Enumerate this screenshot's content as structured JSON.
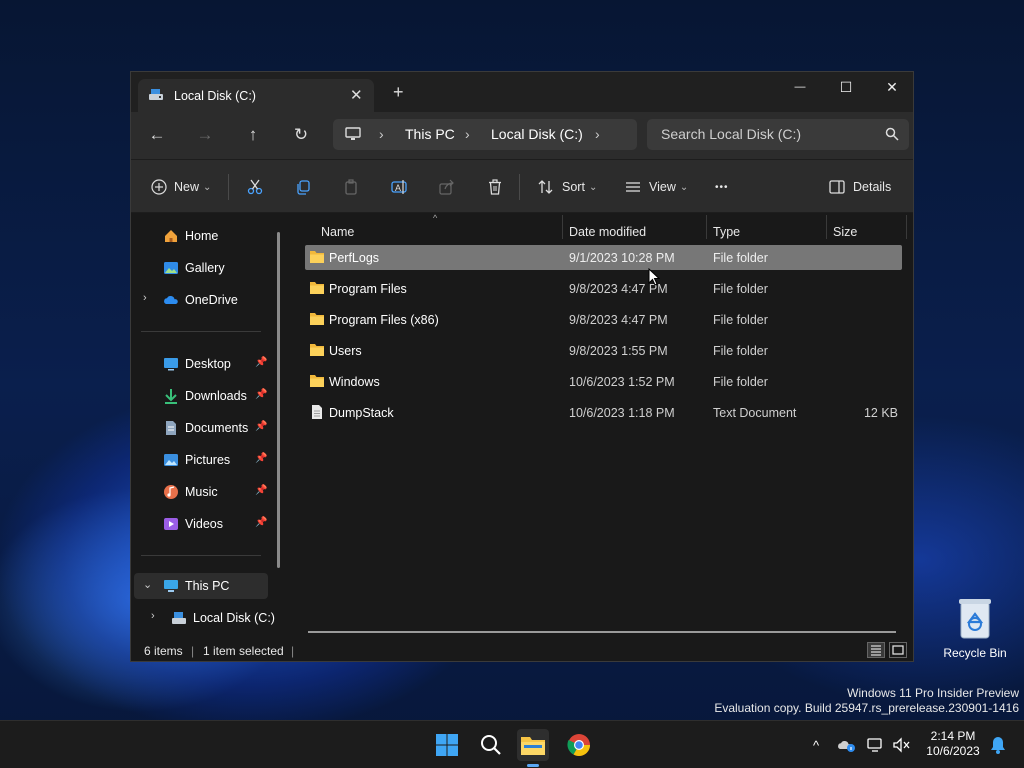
{
  "window": {
    "tab_title": "Local Disk (C:)",
    "tab_close": "✕",
    "new_tab": "+",
    "controls": {
      "minimize": "—",
      "maximize": "☐",
      "close": "✕"
    }
  },
  "navigation": {
    "back": "←",
    "forward": "→",
    "up": "↑",
    "refresh": "↻",
    "breadcrumb": [
      "This PC",
      "Local Disk (C:)"
    ],
    "separator": "›",
    "search_placeholder": "Search Local Disk (C:)"
  },
  "toolbar": {
    "new_label": "New",
    "sort_label": "Sort",
    "view_label": "View",
    "more_label": "•••",
    "details_label": "Details",
    "caret": "⌄"
  },
  "sidebar": {
    "top": [
      {
        "label": "Home",
        "icon": "home-icon"
      },
      {
        "label": "Gallery",
        "icon": "gallery-icon"
      },
      {
        "label": "OneDrive",
        "icon": "onedrive-icon"
      }
    ],
    "quick_access": [
      {
        "label": "Desktop",
        "icon": "desktop-icon"
      },
      {
        "label": "Downloads",
        "icon": "downloads-icon"
      },
      {
        "label": "Documents",
        "icon": "documents-icon"
      },
      {
        "label": "Pictures",
        "icon": "pictures-icon"
      },
      {
        "label": "Music",
        "icon": "music-icon"
      },
      {
        "label": "Videos",
        "icon": "videos-icon"
      }
    ],
    "this_pc": "This PC",
    "local_disk": "Local Disk (C:)",
    "pin": "📌",
    "chev_right": "›",
    "chev_down": "⌄"
  },
  "files": {
    "columns": {
      "name": "Name",
      "date": "Date modified",
      "type": "Type",
      "size": "Size"
    },
    "rows": [
      {
        "name": "PerfLogs",
        "date": "9/1/2023 10:28 PM",
        "type": "File folder",
        "size": "",
        "kind": "folder",
        "selected": true
      },
      {
        "name": "Program Files",
        "date": "9/8/2023 4:47 PM",
        "type": "File folder",
        "size": "",
        "kind": "folder"
      },
      {
        "name": "Program Files (x86)",
        "date": "9/8/2023 4:47 PM",
        "type": "File folder",
        "size": "",
        "kind": "folder"
      },
      {
        "name": "Users",
        "date": "9/8/2023 1:55 PM",
        "type": "File folder",
        "size": "",
        "kind": "folder"
      },
      {
        "name": "Windows",
        "date": "10/6/2023 1:52 PM",
        "type": "File folder",
        "size": "",
        "kind": "folder"
      },
      {
        "name": "DumpStack",
        "date": "10/6/2023 1:18 PM",
        "type": "Text Document",
        "size": "12 KB",
        "kind": "text"
      }
    ]
  },
  "status": {
    "items": "6 items",
    "selected": "1 item selected"
  },
  "desktop": {
    "recycle_bin": "Recycle Bin",
    "watermark_line1": "Windows 11 Pro Insider Preview",
    "watermark_line2": "Evaluation copy. Build 25947.rs_prerelease.230901-1416"
  },
  "taskbar": {
    "time": "2:14 PM",
    "date": "10/6/2023",
    "overflow": "^"
  }
}
